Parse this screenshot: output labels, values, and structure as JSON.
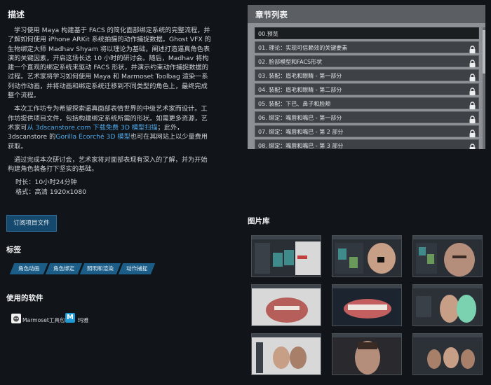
{
  "description": {
    "title": "描述",
    "p1": "学习使用 Maya 构建基于 FACS 的简化面部绑定系统的完整流程，并了解如何使用 iPhone ARKit 系统拍摄的动作捕捉数据。Ghost VFX 的生物绑定大师 Madhav Shyam 将以理论为基础，阐述打造逼真角色表演的关键因素，开启这场长达 10 小时的研讨会。随后，Madhav 将构建一个直观的绑定系统来驱动 FACS 形状，并演示约束动作捕捉数据的过程。艺术家将学习如何使用 Maya 和 Marmoset Toolbag 渲染一系列动作动画，并将动画和绑定系统迁移到不同类型的角色上，最终完成整个流程。",
    "p2_a": "本次工作坊专为希望探索逼真面部表情世界的中级艺术家而设计。工作坊提供项目文件，包括构建绑定系统所需的形状。如需更多资源，艺术家可",
    "p2_link1": "从 3dscanstore.com 下载免费 3D 模型扫描",
    "p2_b": "；此外，3dscanstore 的",
    "p2_link2": "Gorilla Écorché 3D 模型",
    "p2_c": "也可在其网站上以少量费用获取。",
    "p3": "通过完成本次研讨会，艺术家将对面部表现有深入的了解，并为开始构建角色装备打下坚实的基础。",
    "duration": "时长：10小时24分钟",
    "format": "格式：高清 1920x1080"
  },
  "chapters": {
    "title": "章节列表",
    "items": [
      {
        "label": "00.预览",
        "locked": false
      },
      {
        "label": "01. 理论：实现可信赖效的关键要素",
        "locked": true
      },
      {
        "label": "02. 脸部模型和FACS形状",
        "locked": true
      },
      {
        "label": "03. 装配：眉毛和眼睛 - 第一部分",
        "locked": true
      },
      {
        "label": "04. 装配：眉毛和眼睛 - 第二部分",
        "locked": true
      },
      {
        "label": "05. 装配：下巴、鼻子和脸颊",
        "locked": true
      },
      {
        "label": "06. 绑定：嘴唇和嘴巴 - 第一部分",
        "locked": true
      },
      {
        "label": "07. 绑定：嘴唇和嘴巴 - 第 2 部分",
        "locked": true
      },
      {
        "label": "08. 绑定：嘴唇和嘴巴 - 第 3 部分",
        "locked": true
      }
    ]
  },
  "subscribe_button": "订阅项目文件",
  "tags": {
    "title": "标签",
    "items": [
      "角色动画",
      "角色绑定",
      "照明和渲染",
      "动作捕捉"
    ]
  },
  "software": {
    "title": "使用的软件",
    "items": [
      {
        "label": "Marmoset工具包",
        "icon": "marmoset-icon"
      },
      {
        "label": "玛雅",
        "icon": "maya-icon",
        "glyph": "M"
      }
    ]
  },
  "gallery": {
    "title": "图片库",
    "count": 9
  },
  "colors": {
    "background": "#111519",
    "accent": "#1b5d87",
    "link": "#4fa8ea",
    "chapter_panel": "#8d9095"
  }
}
